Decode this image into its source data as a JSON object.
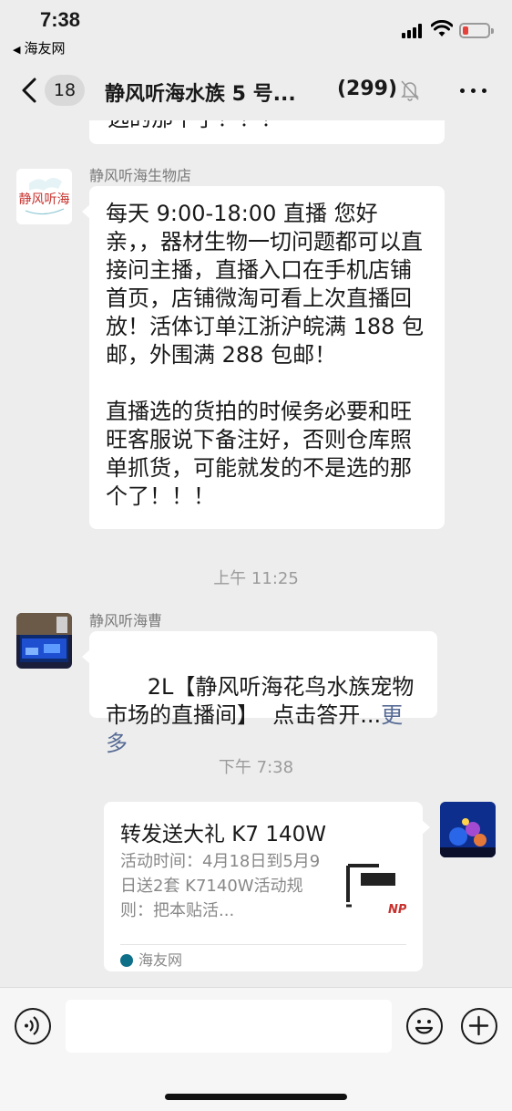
{
  "status_bar": {
    "time": "7:38",
    "back_app": "海友网"
  },
  "nav": {
    "unread_count": "18",
    "title": "静风听海水族 5 号...",
    "member_count": "(299)"
  },
  "chat": {
    "partial_message": "选的那个了！！！",
    "messages": [
      {
        "sender": "静风听海生物店",
        "avatar_text": "静风听海",
        "text": "每天 9:00-18:00 直播 您好亲，，器材生物一切问题都可以直接问主播，直播入口在手机店铺首页，店铺微淘可看上次直播回放！活体订单江浙沪皖满 188 包邮，外围满 288 包邮！\n\n直播选的货拍的时候务必要和旺旺客服说下备注好，否则仓库照单抓货，可能就发的不是选的那个了！！！"
      },
      {
        "timestamp": "上午 11:25"
      },
      {
        "sender": "静风听海曹",
        "text": "2L【静风听海花鸟水族宠物市场的直播间】  点击答开...",
        "more": "更多"
      },
      {
        "timestamp": "下午 7:38"
      },
      {
        "card_title": "转发送大礼 K7 140W",
        "card_desc": "活动时间：4月18日到5月9日送2套 K7140W活动规则：把本贴活...",
        "card_thumb_text": "NP",
        "card_source": "海友网"
      }
    ]
  },
  "input": {
    "placeholder": ""
  }
}
